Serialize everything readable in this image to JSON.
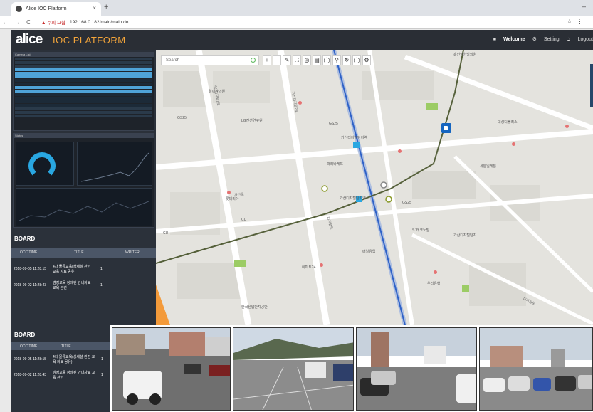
{
  "browser": {
    "tab_title": "Alice IOC Platform",
    "tab_close": "×",
    "new_tab": "+",
    "back": "←",
    "forward": "→",
    "reload": "C",
    "security": "▲ 주의 요함",
    "url": "192.168.0.182/main/main.do"
  },
  "app": {
    "logo_word": "alice",
    "logo_product": "IOC PLATFORM",
    "welcome": "Welcome",
    "setting": "Setting",
    "logout": "Logout"
  },
  "map": {
    "search_placeholder": "Search",
    "zoom_in": "+",
    "zoom_out": "−",
    "labels": [
      "홍인당한방의원",
      "엘이한의원",
      "LG전선연구원",
      "GS25",
      "GS25",
      "파리바게뜨",
      "가산디지털단지역",
      "가산디지털단지역",
      "CU",
      "CU",
      "SJ테크노빌",
      "가산디지털단지",
      "우리은행",
      "세븐일레븐",
      "매일유업",
      "대성디폴리스",
      "GS25",
      "이마트24",
      "롯데리아",
      "한국산업단지공단"
    ],
    "roads": [
      "가산디지털1로",
      "가산디지털2로",
      "디지털로",
      "가산로",
      "디지털로"
    ]
  },
  "board": {
    "title": "BOARD",
    "columns": [
      "OCC TIME",
      "TITLE",
      "WRITER"
    ],
    "rows": [
      {
        "time": "2018-09-05 11:28:15",
        "title": "4차 물류교육(상세설 관련 교육 자료 공유)",
        "writer": "1"
      },
      {
        "time": "2018-09-02 11:28:43",
        "title": "범정교육 정례된 안내자료 교육 관련",
        "writer": "1"
      }
    ]
  },
  "panels": {
    "panel1_title": "Camera List",
    "panel2_title": "Status"
  },
  "icons": {
    "favicon": "globe-icon",
    "camera": "camera-icon",
    "search": "search-icon",
    "setting": "gear-icon",
    "logout": "logout-icon",
    "user": "user-icon"
  }
}
